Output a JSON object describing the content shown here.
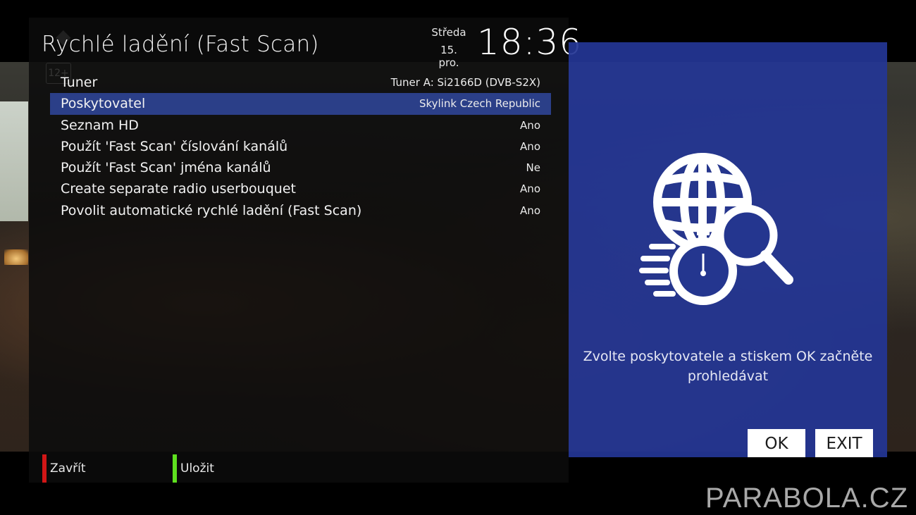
{
  "header": {
    "title": "Rychlé ladění (Fast Scan)",
    "day": "Středa",
    "date": "15. pro.",
    "time": "18:36"
  },
  "settings": [
    {
      "label": "Tuner",
      "value": "Tuner A: Si2166D (DVB-S2X)"
    },
    {
      "label": "Poskytovatel",
      "value": "Skylink Czech Republic",
      "selected": true
    },
    {
      "label": "Seznam HD",
      "value": "Ano"
    },
    {
      "label": "Použít 'Fast Scan' číslování kanálů",
      "value": "Ano"
    },
    {
      "label": "Použít 'Fast Scan' jména kanálů",
      "value": "Ne"
    },
    {
      "label": "Create separate radio userbouquet",
      "value": "Ano"
    },
    {
      "label": "Povolit automatické rychlé ladění (Fast Scan)",
      "value": "Ano"
    }
  ],
  "footer": {
    "red_label": "Zavřít",
    "green_label": "Uložit"
  },
  "info": {
    "icon": "globe-search-stopwatch-icon",
    "text_line1": "Zvolte poskytovatele a stiskem OK začněte",
    "text_line2": "prohledávat",
    "ok_label": "OK",
    "exit_label": "EXIT"
  },
  "watermark": "PARABOLA.CZ",
  "colors": {
    "selected_row": "#2b3f88",
    "info_panel": "#24368f",
    "red_key": "#d11616",
    "green_key": "#5ee01f"
  }
}
